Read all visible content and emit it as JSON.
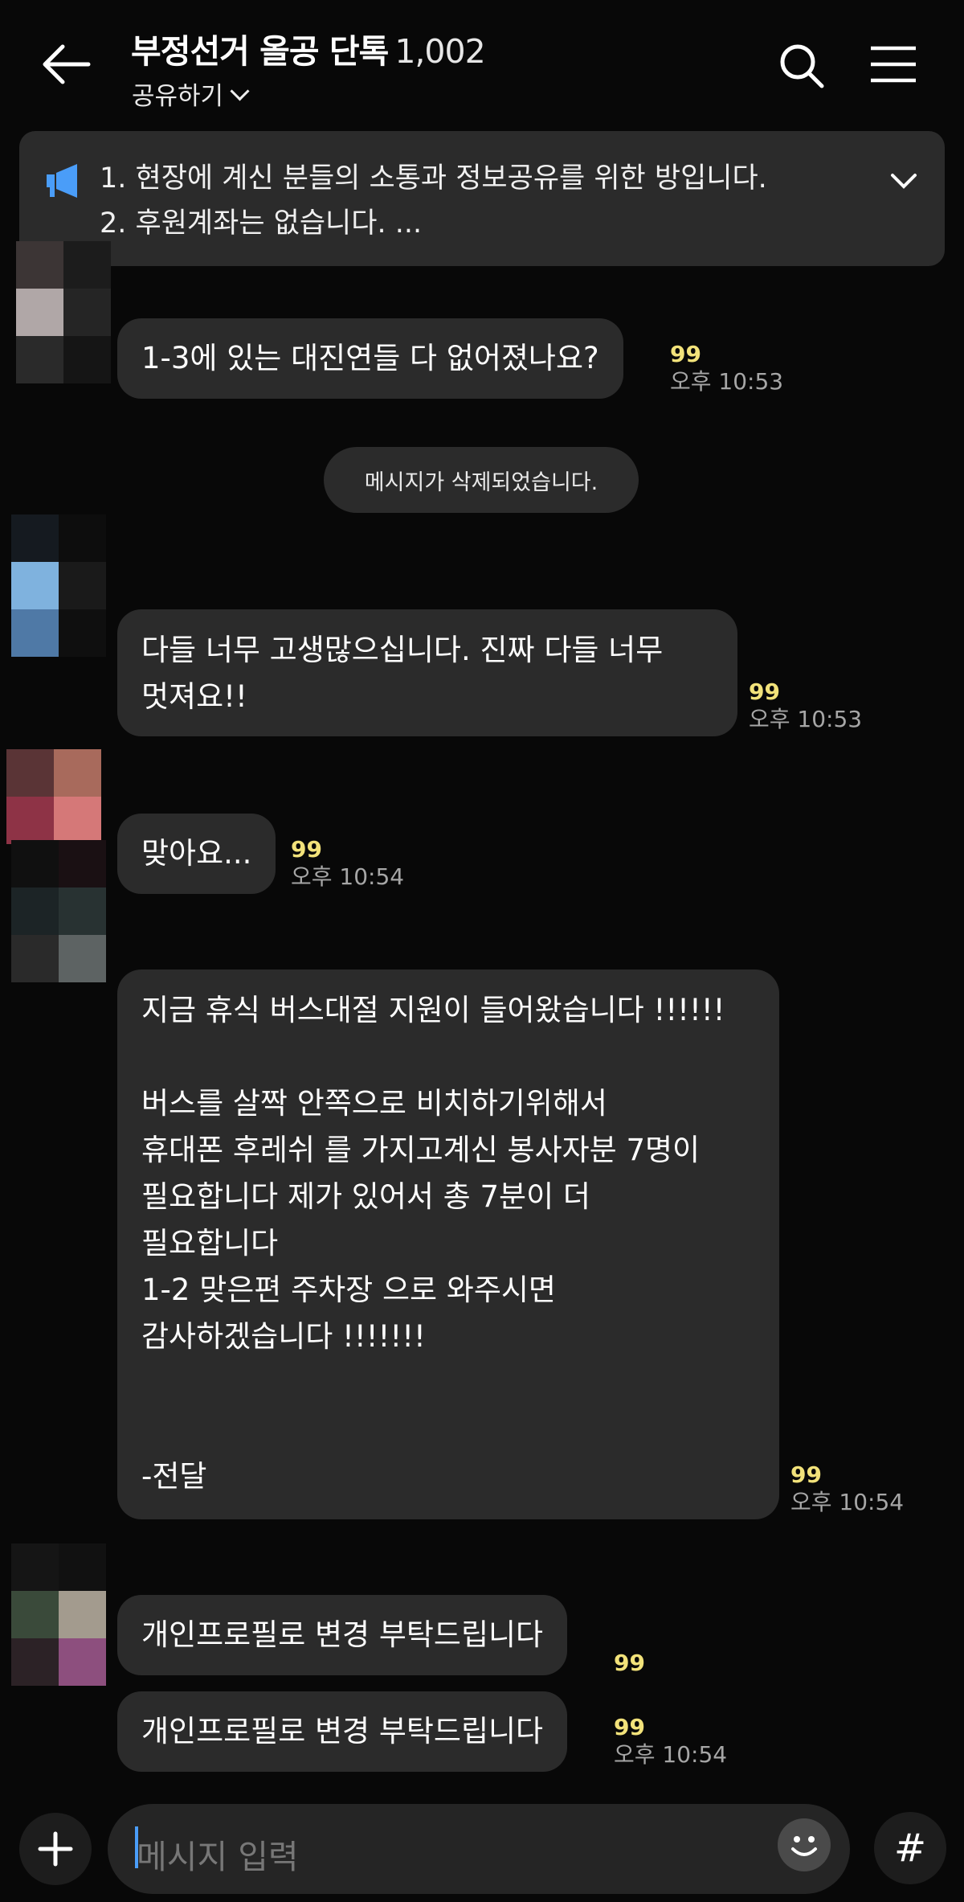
{
  "header": {
    "title": "부정선거 올공 단톡",
    "member_count": "1,002",
    "share_label": "공유하기",
    "icons": [
      "back-arrow-icon",
      "chevron-down-icon",
      "search-icon",
      "menu-icon"
    ]
  },
  "notice": {
    "line1": "1. 현장에 계신 분들의 소통과 정보공유를 위한 방입니다.",
    "line2": "2. 후원계좌는 없습니다. ...",
    "icons": [
      "megaphone-icon",
      "chevron-down-icon"
    ]
  },
  "messages": [
    {
      "text": "1-3에 있는 대진연들 다 없어졌나요?",
      "unread": "99",
      "time": "오후 10:53"
    },
    {
      "system": "메시지가 삭제되었습니다."
    },
    {
      "text": "다들 너무 고생많으십니다. 진짜 다들 너무\n멋져요!!",
      "unread": "99",
      "time": "오후 10:53"
    },
    {
      "text": "맞아요...",
      "unread": "99",
      "time": "오후 10:54"
    },
    {
      "text": "지금 휴식 버스대절 지원이 들어왔습니다 !!!!!!\n\n버스를 살짝 안쪽으로 비치하기위해서\n휴대폰 후레쉬 를 가지고계신 봉사자분 7명이\n필요합니다 제가 있어서 총 7분이 더\n필요합니다\n1-2 맞은편 주차장 으로 와주시면\n감사하겠습니다 !!!!!!!\n\n\n-전달",
      "unread": "99",
      "time": "오후 10:54"
    },
    {
      "text": "개인프로필로 변경 부탁드립니다",
      "unread": "99"
    },
    {
      "text": "개인프로필로 변경 부탁드립니다",
      "unread": "99",
      "time": "오후 10:54"
    }
  ],
  "input": {
    "placeholder": "메시지 입력",
    "icons": [
      "plus-icon",
      "emoji-icon",
      "hashtag-icon"
    ],
    "hash_symbol": "#"
  },
  "colors": {
    "background": "#080808",
    "bubble": "#2b2b2b",
    "unread": "#f2e27a",
    "time": "#a6a6a6",
    "notice_icon": "#4a9df8"
  }
}
